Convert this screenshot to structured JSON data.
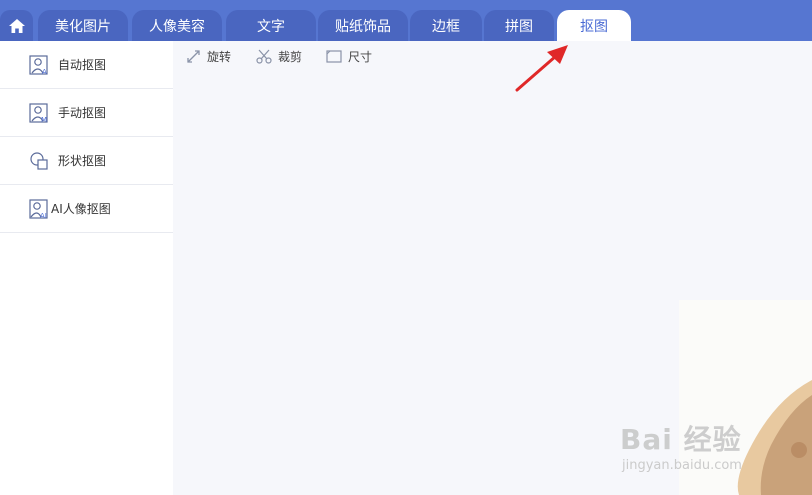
{
  "tabs": [
    {
      "label": "美化图片",
      "active": false
    },
    {
      "label": "人像美容",
      "active": false
    },
    {
      "label": "文字",
      "active": false
    },
    {
      "label": "贴纸饰品",
      "active": false
    },
    {
      "label": "边框",
      "active": false
    },
    {
      "label": "拼图",
      "active": false
    },
    {
      "label": "抠图",
      "active": true
    }
  ],
  "home_icon": "home-icon",
  "sidebar": {
    "items": [
      {
        "label": "自动抠图",
        "icon": "auto-cutout-icon"
      },
      {
        "label": "手动抠图",
        "icon": "manual-cutout-icon"
      },
      {
        "label": "形状抠图",
        "icon": "shape-cutout-icon"
      },
      {
        "label": "AI人像抠图",
        "icon": "ai-portrait-cutout-icon"
      }
    ]
  },
  "toolbar": {
    "rotate_label": "旋转",
    "crop_label": "裁剪",
    "size_label": "尺寸"
  },
  "watermark": {
    "main": "Bai 经验",
    "sub": "jingyan.baidu.com"
  },
  "colors": {
    "accent": "#5676d1",
    "active_tab_text": "#4a6bd4",
    "annotation_arrow": "#e02828"
  }
}
